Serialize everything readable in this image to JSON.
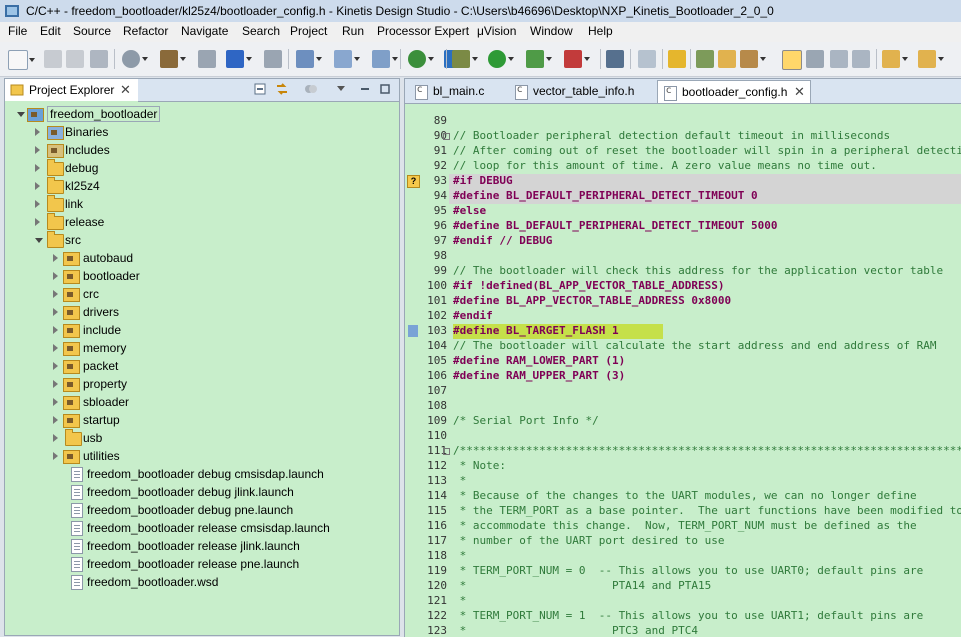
{
  "window": {
    "title": "C/C++ - freedom_bootloader/kl25z4/bootloader_config.h - Kinetis Design Studio - C:\\Users\\b46696\\Desktop\\NXP_Kinetis_Bootloader_2_0_0",
    "icon": "app-icon"
  },
  "menu": [
    "File",
    "Edit",
    "Source",
    "Refactor",
    "Navigate",
    "Search",
    "Project",
    "Run",
    "Processor Expert",
    "μVision",
    "Window",
    "Help"
  ],
  "project_explorer": {
    "tab_label": "Project Explorer",
    "tree": [
      {
        "label": "freedom_bootloader",
        "type": "project",
        "depth": 0,
        "expanded": true
      },
      {
        "label": "Binaries",
        "type": "binaries",
        "depth": 1,
        "expanded": false
      },
      {
        "label": "Includes",
        "type": "includes",
        "depth": 1,
        "expanded": false
      },
      {
        "label": "debug",
        "type": "folder",
        "depth": 1,
        "expanded": false
      },
      {
        "label": "kl25z4",
        "type": "folder",
        "depth": 1,
        "expanded": false
      },
      {
        "label": "link",
        "type": "folder",
        "depth": 1,
        "expanded": false
      },
      {
        "label": "release",
        "type": "folder",
        "depth": 1,
        "expanded": false
      },
      {
        "label": "src",
        "type": "folder",
        "depth": 1,
        "expanded": true
      },
      {
        "label": "autobaud",
        "type": "srcfolder",
        "depth": 2,
        "expanded": false
      },
      {
        "label": "bootloader",
        "type": "srcfolder",
        "depth": 2,
        "expanded": false
      },
      {
        "label": "crc",
        "type": "srcfolder",
        "depth": 2,
        "expanded": false
      },
      {
        "label": "drivers",
        "type": "srcfolder",
        "depth": 2,
        "expanded": false
      },
      {
        "label": "include",
        "type": "srcfolder",
        "depth": 2,
        "expanded": false
      },
      {
        "label": "memory",
        "type": "srcfolder",
        "depth": 2,
        "expanded": false
      },
      {
        "label": "packet",
        "type": "srcfolder",
        "depth": 2,
        "expanded": false
      },
      {
        "label": "property",
        "type": "srcfolder",
        "depth": 2,
        "expanded": false
      },
      {
        "label": "sbloader",
        "type": "srcfolder",
        "depth": 2,
        "expanded": false
      },
      {
        "label": "startup",
        "type": "srcfolder",
        "depth": 2,
        "expanded": false
      },
      {
        "label": "usb",
        "type": "folder",
        "depth": 2,
        "expanded": false
      },
      {
        "label": "utilities",
        "type": "srcfolder",
        "depth": 2,
        "expanded": false
      },
      {
        "label": "freedom_bootloader debug cmsisdap.launch",
        "type": "file",
        "depth": 1
      },
      {
        "label": "freedom_bootloader debug jlink.launch",
        "type": "file",
        "depth": 1
      },
      {
        "label": "freedom_bootloader debug pne.launch",
        "type": "file",
        "depth": 1
      },
      {
        "label": "freedom_bootloader release cmsisdap.launch",
        "type": "file",
        "depth": 1
      },
      {
        "label": "freedom_bootloader release jlink.launch",
        "type": "file",
        "depth": 1
      },
      {
        "label": "freedom_bootloader release pne.launch",
        "type": "file",
        "depth": 1
      },
      {
        "label": "freedom_bootloader.wsd",
        "type": "file",
        "depth": 1
      }
    ]
  },
  "editor": {
    "tabs": [
      {
        "label": "bl_main.c",
        "active": false
      },
      {
        "label": "vector_table_info.h",
        "active": false
      },
      {
        "label": "bootloader_config.h",
        "active": true
      }
    ],
    "lines": [
      {
        "n": "89",
        "t": "",
        "k": "txt"
      },
      {
        "n": "90",
        "t": "// Bootloader peripheral detection default timeout in milliseconds",
        "k": "cmt",
        "fold": true
      },
      {
        "n": "91",
        "t": "// After coming out of reset the bootloader will spin in a peripheral detection",
        "k": "cmt"
      },
      {
        "n": "92",
        "t": "// loop for this amount of time. A zero value means no time out.",
        "k": "cmt"
      },
      {
        "n": "93",
        "t": "#if DEBUG",
        "k": "pp",
        "hl": "gray",
        "ann": "q"
      },
      {
        "n": "94",
        "t": "#define BL_DEFAULT_PERIPHERAL_DETECT_TIMEOUT 0",
        "k": "pp",
        "hl": "gray"
      },
      {
        "n": "95",
        "t": "#else",
        "k": "pp"
      },
      {
        "n": "96",
        "t": "#define BL_DEFAULT_PERIPHERAL_DETECT_TIMEOUT 5000",
        "k": "pp"
      },
      {
        "n": "97",
        "t": "#endif // DEBUG",
        "k": "pp"
      },
      {
        "n": "98",
        "t": "",
        "k": "txt"
      },
      {
        "n": "99",
        "t": "// The bootloader will check this address for the application vector table",
        "k": "cmt"
      },
      {
        "n": "100",
        "t": "#if !defined(BL_APP_VECTOR_TABLE_ADDRESS)",
        "k": "pp"
      },
      {
        "n": "101",
        "t": "#define BL_APP_VECTOR_TABLE_ADDRESS 0x8000",
        "k": "pp"
      },
      {
        "n": "102",
        "t": "#endif",
        "k": "pp"
      },
      {
        "n": "103",
        "t": "#define BL_TARGET_FLASH 1",
        "k": "pp",
        "hl": "lime",
        "ann": "bar"
      },
      {
        "n": "104",
        "t": "// The bootloader will calculate the start address and end address of RAM",
        "k": "cmt"
      },
      {
        "n": "105",
        "t": "#define RAM_LOWER_PART (1)",
        "k": "pp"
      },
      {
        "n": "106",
        "t": "#define RAM_UPPER_PART (3)",
        "k": "pp"
      },
      {
        "n": "107",
        "t": "",
        "k": "txt"
      },
      {
        "n": "108",
        "t": "",
        "k": "txt"
      },
      {
        "n": "109",
        "t": "/* Serial Port Info */",
        "k": "cmt"
      },
      {
        "n": "110",
        "t": "",
        "k": "txt"
      },
      {
        "n": "111",
        "t": "/******************************************************************************",
        "k": "cmt",
        "fold": true
      },
      {
        "n": "112",
        "t": " * Note:",
        "k": "cmt"
      },
      {
        "n": "113",
        "t": " *",
        "k": "cmt"
      },
      {
        "n": "114",
        "t": " * Because of the changes to the UART modules, we can no longer define",
        "k": "cmt"
      },
      {
        "n": "115",
        "t": " * the TERM_PORT as a base pointer.  The uart functions have been modified to",
        "k": "cmt"
      },
      {
        "n": "116",
        "t": " * accommodate this change.  Now, TERM_PORT_NUM must be defined as the",
        "k": "cmt"
      },
      {
        "n": "117",
        "t": " * number of the UART port desired to use",
        "k": "cmt"
      },
      {
        "n": "118",
        "t": " *",
        "k": "cmt"
      },
      {
        "n": "119",
        "t": " * TERM_PORT_NUM = 0  -- This allows you to use UART0; default pins are",
        "k": "cmt"
      },
      {
        "n": "120",
        "t": " *                      PTA14 and PTA15",
        "k": "cmt"
      },
      {
        "n": "121",
        "t": " *",
        "k": "cmt"
      },
      {
        "n": "122",
        "t": " * TERM_PORT_NUM = 1  -- This allows you to use UART1; default pins are",
        "k": "cmt"
      },
      {
        "n": "123",
        "t": " *                      PTC3 and PTC4",
        "k": "cmt"
      }
    ]
  }
}
